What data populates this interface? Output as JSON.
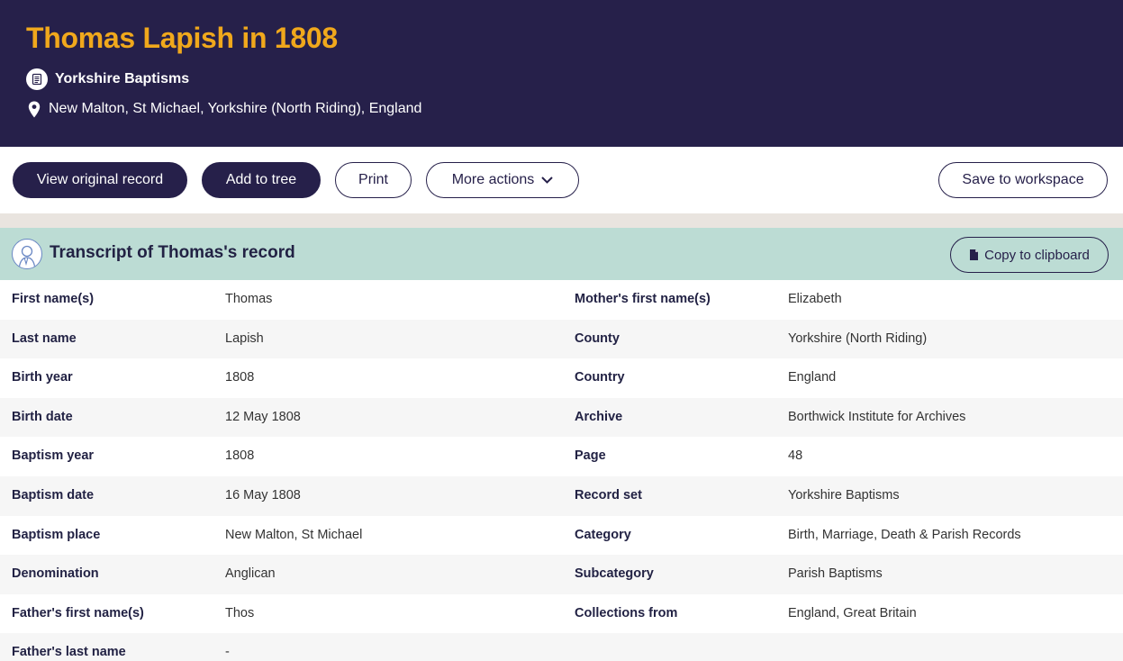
{
  "header": {
    "title": "Thomas Lapish in 1808",
    "collection": "Yorkshire Baptisms",
    "location": "New Malton, St Michael, Yorkshire (North Riding), England",
    "background_color": "#26204a",
    "title_color": "#f0a81c",
    "collection_icon": "document-icon",
    "location_icon": "map-pin-icon"
  },
  "actions": {
    "view_original": "View original record",
    "add_to_tree": "Add to tree",
    "print": "Print",
    "more_actions": "More actions",
    "save_to_workspace": "Save to workspace"
  },
  "transcript": {
    "title": "Transcript of Thomas's record",
    "copy_button": "Copy to clipboard",
    "header_color": "#bcdcd4",
    "rows": [
      {
        "label1": "First name(s)",
        "value1": "Thomas",
        "label2": "Mother's first name(s)",
        "value2": "Elizabeth"
      },
      {
        "label1": "Last name",
        "value1": "Lapish",
        "label2": "County",
        "value2": "Yorkshire (North Riding)"
      },
      {
        "label1": "Birth year",
        "value1": "1808",
        "label2": "Country",
        "value2": "England"
      },
      {
        "label1": "Birth date",
        "value1": "12 May 1808",
        "label2": "Archive",
        "value2": "Borthwick Institute for Archives"
      },
      {
        "label1": "Baptism year",
        "value1": "1808",
        "label2": "Page",
        "value2": "48"
      },
      {
        "label1": "Baptism date",
        "value1": "16 May 1808",
        "label2": "Record set",
        "value2": "Yorkshire Baptisms"
      },
      {
        "label1": "Baptism place",
        "value1": "New Malton, St Michael",
        "label2": "Category",
        "value2": "Birth, Marriage, Death & Parish Records"
      },
      {
        "label1": "Denomination",
        "value1": "Anglican",
        "label2": "Subcategory",
        "value2": "Parish Baptisms"
      },
      {
        "label1": "Father's first name(s)",
        "value1": "Thos",
        "label2": "Collections from",
        "value2": "England, Great Britain"
      },
      {
        "label1": "Father's last name",
        "value1": "-",
        "label2": "",
        "value2": ""
      }
    ]
  }
}
